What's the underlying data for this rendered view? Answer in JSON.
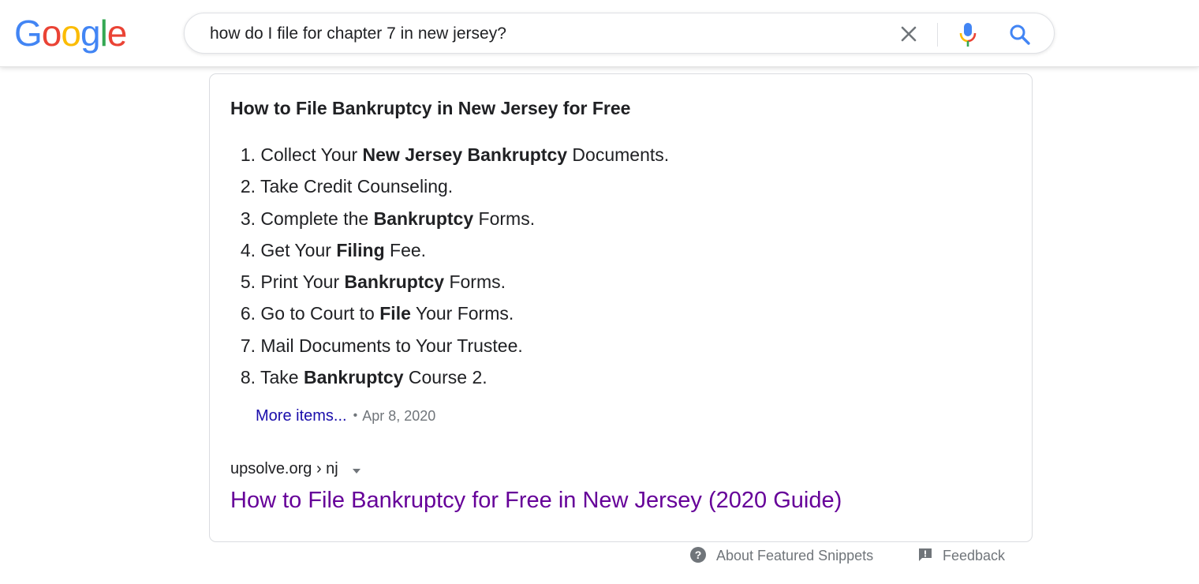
{
  "header": {
    "logo_letters": [
      {
        "char": "G",
        "color": "#4285f4"
      },
      {
        "char": "o",
        "color": "#ea4335"
      },
      {
        "char": "o",
        "color": "#fbbc05"
      },
      {
        "char": "g",
        "color": "#4285f4"
      },
      {
        "char": "l",
        "color": "#34a853"
      },
      {
        "char": "e",
        "color": "#ea4335"
      }
    ],
    "search": {
      "value": "how do I file for chapter 7 in new jersey?",
      "clear_icon": "close-icon",
      "mic_icon": "mic-icon",
      "search_icon": "search-icon"
    }
  },
  "snippet": {
    "title": "How to File Bankruptcy in New Jersey for Free",
    "steps": [
      {
        "num": "1.",
        "parts": [
          {
            "t": "Collect Your ",
            "b": false
          },
          {
            "t": "New Jersey Bankruptcy",
            "b": true
          },
          {
            "t": " Documents.",
            "b": false
          }
        ]
      },
      {
        "num": "2.",
        "parts": [
          {
            "t": "Take Credit Counseling.",
            "b": false
          }
        ]
      },
      {
        "num": "3.",
        "parts": [
          {
            "t": "Complete the ",
            "b": false
          },
          {
            "t": "Bankruptcy",
            "b": true
          },
          {
            "t": " Forms.",
            "b": false
          }
        ]
      },
      {
        "num": "4.",
        "parts": [
          {
            "t": "Get Your ",
            "b": false
          },
          {
            "t": "Filing",
            "b": true
          },
          {
            "t": " Fee.",
            "b": false
          }
        ]
      },
      {
        "num": "5.",
        "parts": [
          {
            "t": "Print Your ",
            "b": false
          },
          {
            "t": "Bankruptcy",
            "b": true
          },
          {
            "t": " Forms.",
            "b": false
          }
        ]
      },
      {
        "num": "6.",
        "parts": [
          {
            "t": "Go to Court to ",
            "b": false
          },
          {
            "t": "File",
            "b": true
          },
          {
            "t": " Your Forms.",
            "b": false
          }
        ]
      },
      {
        "num": "7.",
        "parts": [
          {
            "t": "Mail Documents to Your Trustee.",
            "b": false
          }
        ]
      },
      {
        "num": "8.",
        "parts": [
          {
            "t": "Take ",
            "b": false
          },
          {
            "t": "Bankruptcy",
            "b": true
          },
          {
            "t": " Course 2.",
            "b": false
          }
        ]
      }
    ],
    "more_items": "More items...",
    "bullet": "•",
    "date": "Apr 8, 2020",
    "cite": "upsolve.org › nj",
    "result_title": "How to File Bankruptcy for Free in New Jersey (2020 Guide)"
  },
  "footer": {
    "about": "About Featured Snippets",
    "feedback": "Feedback"
  },
  "colors": {
    "link_visited": "#660099",
    "link_more": "#1a0dab",
    "muted": "#70757a"
  }
}
